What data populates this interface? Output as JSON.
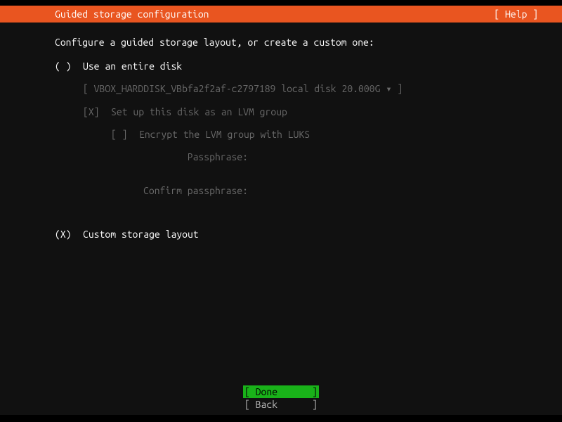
{
  "header": {
    "title": "Guided storage configuration",
    "help": "[ Help ]"
  },
  "intro": "Configure a guided storage layout, or create a custom one:",
  "option1": {
    "radio": "( )",
    "label": "Use an entire disk"
  },
  "disk": {
    "text": "[ VBOX_HARDDISK_VBbfa2f2af-c2797189 local disk 20.000G ▾ ]"
  },
  "lvm": {
    "checkbox": "[X]",
    "label": "Set up this disk as an LVM group"
  },
  "encrypt": {
    "checkbox": "[ ]",
    "label": "Encrypt the LVM group with LUKS"
  },
  "passphrase": {
    "label": "Passphrase:"
  },
  "confirm": {
    "label": "Confirm passphrase:"
  },
  "option2": {
    "radio": "(X)",
    "label": "Custom storage layout"
  },
  "buttons": {
    "done": "Done",
    "back": "Back"
  }
}
